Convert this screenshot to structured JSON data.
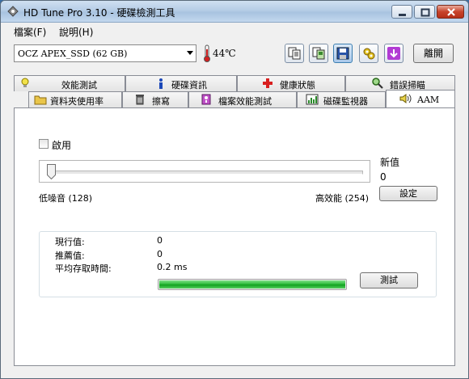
{
  "window": {
    "title": "HD Tune Pro 3.10 - 硬碟檢測工具",
    "accent": "#b6cde6"
  },
  "menu": {
    "file": "檔案(F)",
    "help": "說明(H)"
  },
  "toolbar": {
    "drive": "OCZ APEX_SSD (62 GB)",
    "temperature": "44℃",
    "exit_label": "離開",
    "icons": [
      "copy-text-icon",
      "copy-screenshot-icon",
      "save-icon",
      "options-icon",
      "download-icon"
    ]
  },
  "tabs": {
    "top": [
      "效能測試",
      "硬碟資訊",
      "健康狀態",
      "錯誤掃瞄"
    ],
    "bottom": [
      "資料夾使用率",
      "擦寫",
      "檔案效能測試",
      "磁碟監視器",
      "AAM"
    ],
    "selected": "AAM"
  },
  "aam": {
    "enable_label": "啟用",
    "new_value_label": "新值",
    "new_value": "0",
    "low_noise_label": "低噪音 (128)",
    "high_perf_label": "高效能 (254)",
    "set_label": "設定",
    "slider_value": 0
  },
  "results": {
    "current_label": "現行值:",
    "current_value": "0",
    "recommended_label": "推薦值:",
    "recommended_value": "0",
    "access_label": "平均存取時間:",
    "access_value": "0.2 ms",
    "test_label": "測試",
    "progress": 1.0,
    "progress_color": "#2fbd3c"
  }
}
